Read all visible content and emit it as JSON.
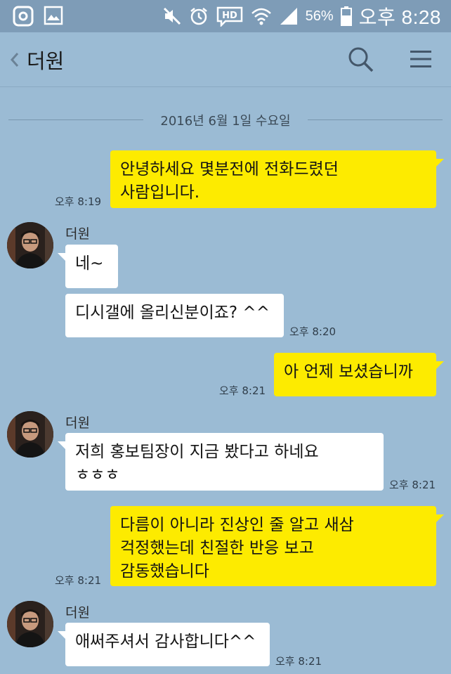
{
  "status_bar": {
    "battery_percent": "56%",
    "clock": "오후 8:28",
    "icons": [
      "g-app-icon",
      "gallery-icon",
      "mute-icon",
      "alarm-icon",
      "hd-voice-icon",
      "wifi-icon",
      "signal-icon",
      "battery-icon"
    ]
  },
  "header": {
    "title": "더원",
    "icons": [
      "back-chevron-icon",
      "search-icon",
      "menu-icon"
    ]
  },
  "date_divider": "2016년 6월 1일 수요일",
  "messages": [
    {
      "from": "me",
      "lines": [
        "안녕하세요 몇분전에 전화드렸던",
        "사람입니다."
      ],
      "time": "오후 8:19"
    },
    {
      "from": "other",
      "sender": "더원",
      "lines": [
        "네~"
      ]
    },
    {
      "from": "other",
      "lines": [
        "디시갤에 올리신분이죠? ^^"
      ],
      "time": "오후 8:20"
    },
    {
      "from": "me",
      "lines": [
        "아 언제 보셨습니까"
      ],
      "time": "오후 8:21"
    },
    {
      "from": "other",
      "sender": "더원",
      "lines": [
        "저희 홍보팀장이 지금 봤다고 하네요",
        "ㅎㅎㅎ"
      ],
      "time": "오후 8:21"
    },
    {
      "from": "me",
      "lines": [
        "다름이 아니라 진상인 줄 알고 새삼",
        "걱정했는데 친절한 반응 보고",
        "감동했습니다"
      ],
      "time": "오후 8:21"
    },
    {
      "from": "other",
      "sender": "더원",
      "lines": [
        "애써주셔서 감사합니다^^"
      ],
      "time": "오후 8:21"
    }
  ],
  "colors": {
    "background": "#9bbbd4",
    "status_bar": "#7e9cb7",
    "my_bubble": "#fdeb00",
    "other_bubble": "#ffffff"
  }
}
